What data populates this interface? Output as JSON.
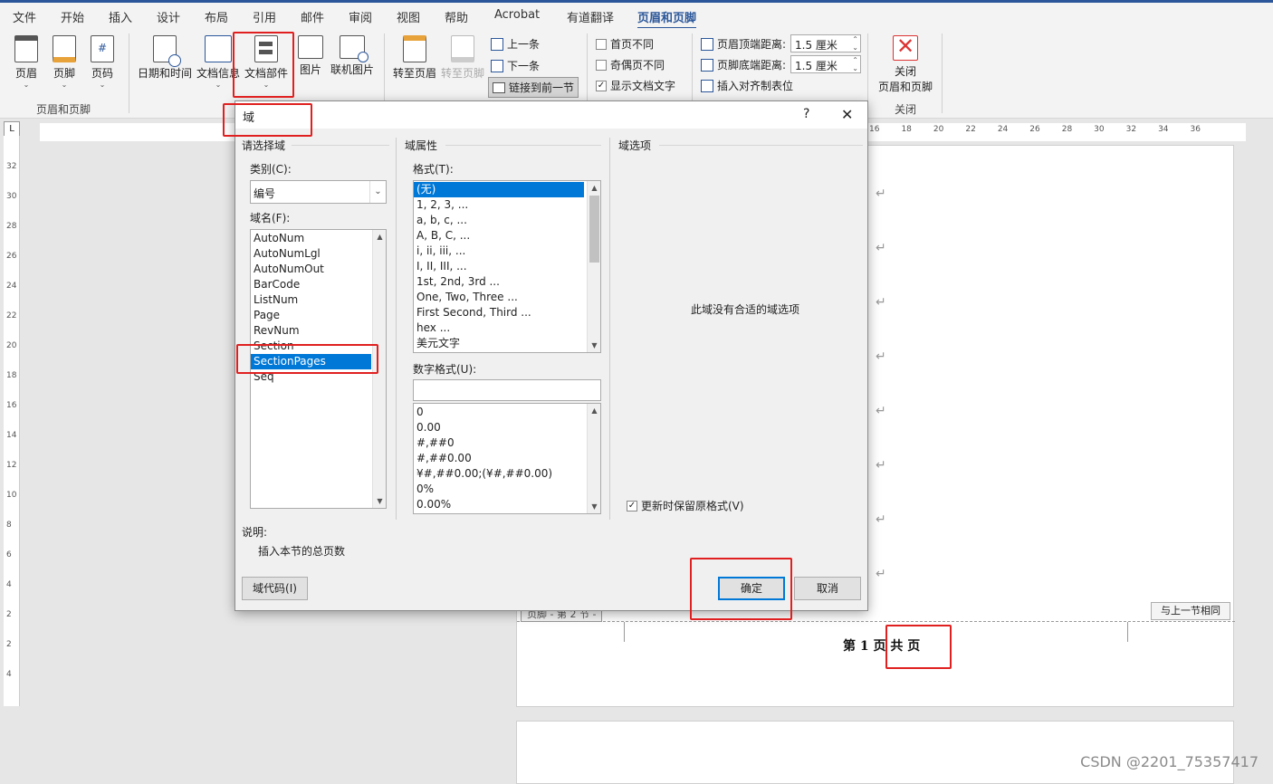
{
  "tabs": [
    "文件",
    "开始",
    "插入",
    "设计",
    "布局",
    "引用",
    "邮件",
    "审阅",
    "视图",
    "帮助",
    "Acrobat",
    "有道翻译",
    "页眉和页脚"
  ],
  "ribbon": {
    "header_btn": "页眉",
    "footer_btn": "页脚",
    "pagenum_btn": "页码",
    "group1_label": "页眉和页脚",
    "date_btn": "日期和时间",
    "docinfo_btn": "文档信息",
    "docparts_btn": "文档部件",
    "picture_btn": "图片",
    "online_picture_btn": "联机图片",
    "goto_header_btn": "转至页眉",
    "goto_footer_btn": "转至页脚",
    "prev_btn": "上一条",
    "next_btn": "下一条",
    "link_prev_btn": "链接到前一节",
    "diff_first": "首页不同",
    "diff_odd_even": "奇偶页不同",
    "show_doc_text": "显示文档文字",
    "header_top_label": "页眉顶端距离:",
    "header_top_value": "1.5 厘米",
    "footer_bottom_label": "页脚底端距离:",
    "footer_bottom_value": "1.5 厘米",
    "insert_align_tab": "插入对齐制表位",
    "close_btn_line1": "关闭",
    "close_btn_line2": "页眉和页脚",
    "close_group_label": "关闭"
  },
  "dialog": {
    "title": "域",
    "help": "?",
    "close": "✕",
    "choose_field_section": "请选择域",
    "category_label": "类别(C):",
    "category_value": "编号",
    "field_names_label": "域名(F):",
    "field_names": [
      "AutoNum",
      "AutoNumLgl",
      "AutoNumOut",
      "BarCode",
      "ListNum",
      "Page",
      "RevNum",
      "Section",
      "SectionPages",
      "Seq"
    ],
    "selected_field": "SectionPages",
    "field_props_section": "域属性",
    "format_label": "格式(T):",
    "formats": [
      "(无)",
      "1, 2, 3, ...",
      "a, b, c, ...",
      "A, B, C, ...",
      "i, ii, iii, ...",
      "I, II, III, ...",
      "1st, 2nd, 3rd ...",
      "One, Two, Three ...",
      "First Second, Third ...",
      "hex ...",
      "美元文字"
    ],
    "selected_format": "(无)",
    "number_format_label": "数字格式(U):",
    "number_format_value": "",
    "number_formats": [
      "0",
      "0.00",
      "#,##0",
      "#,##0.00",
      "¥#,##0.00;(¥#,##0.00)",
      "0%",
      "0.00%"
    ],
    "field_options_section": "域选项",
    "no_options_text": "此域没有合适的域选项",
    "preserve_format_label": "更新时保留原格式(V)",
    "description_label": "说明:",
    "description_text": "插入本节的总页数",
    "field_codes_btn": "域代码(I)",
    "ok_btn": "确定",
    "cancel_btn": "取消"
  },
  "document": {
    "footer_tag": "页脚 - 第 2 节 -",
    "same_as_prev": "与上一节相同",
    "footer_text": "第 1 页 共 页",
    "return_mark": "↵"
  },
  "ruler_ticks": [
    "16",
    "18",
    "20",
    "22",
    "24",
    "26",
    "28",
    "30",
    "32",
    "34",
    "36"
  ],
  "vruler_ticks": [
    "32",
    "30",
    "28",
    "26",
    "24",
    "22",
    "20",
    "18",
    "16",
    "14",
    "12",
    "10",
    "8",
    "6",
    "4",
    "2",
    "2",
    "4"
  ],
  "watermark": "CSDN @2201_75357417",
  "colors": {
    "accent": "#2b579a",
    "selection": "#0078d7",
    "highlight_box": "#e02020"
  }
}
